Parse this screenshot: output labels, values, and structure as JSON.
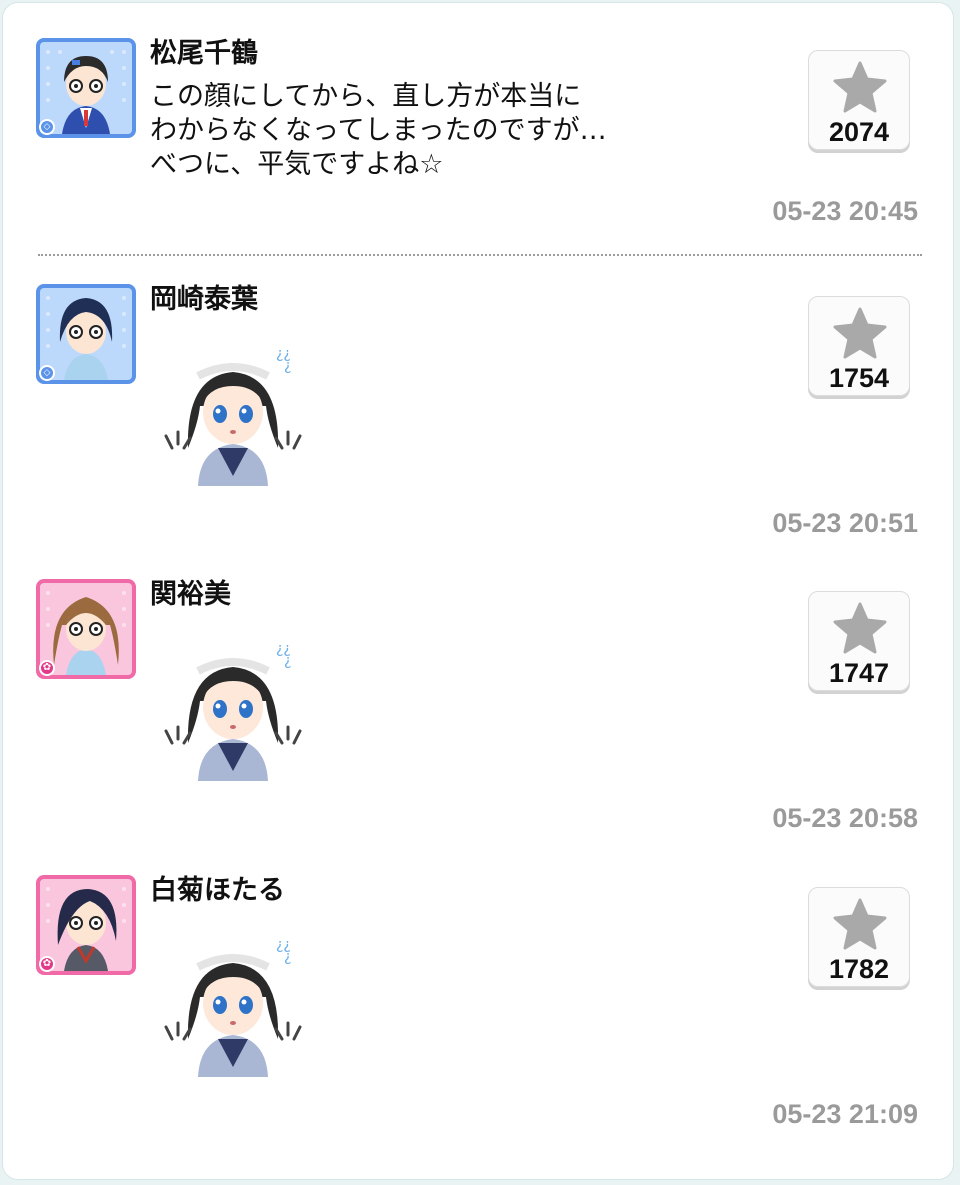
{
  "posts": [
    {
      "name": "松尾千鶴",
      "message_lines": [
        "この顔にしてから、直し方が本当に",
        "わからなくなってしまったのですが…",
        "べつに、平気ですよね☆"
      ],
      "likes": "2074",
      "time": "05-23 20:45",
      "avatar_frame": "blue",
      "badge_icon": "diamond-icon"
    },
    {
      "name": "岡崎泰葉",
      "sticker": "surprised-girl-sticker",
      "likes": "1754",
      "time": "05-23 20:51",
      "avatar_frame": "blue",
      "badge_icon": "diamond-icon"
    },
    {
      "name": "関裕美",
      "sticker": "surprised-girl-sticker",
      "likes": "1747",
      "time": "05-23 20:58",
      "avatar_frame": "pink",
      "badge_icon": "flower-icon"
    },
    {
      "name": "白菊ほたる",
      "sticker": "surprised-girl-sticker",
      "likes": "1782",
      "time": "05-23 21:09",
      "avatar_frame": "pink",
      "badge_icon": "flower-icon"
    }
  ],
  "colors": {
    "blue_frame": "#5b93e8",
    "pink_frame": "#ef6aa7",
    "timestamp": "#9a9a9a",
    "star": "#a9a9a9"
  }
}
